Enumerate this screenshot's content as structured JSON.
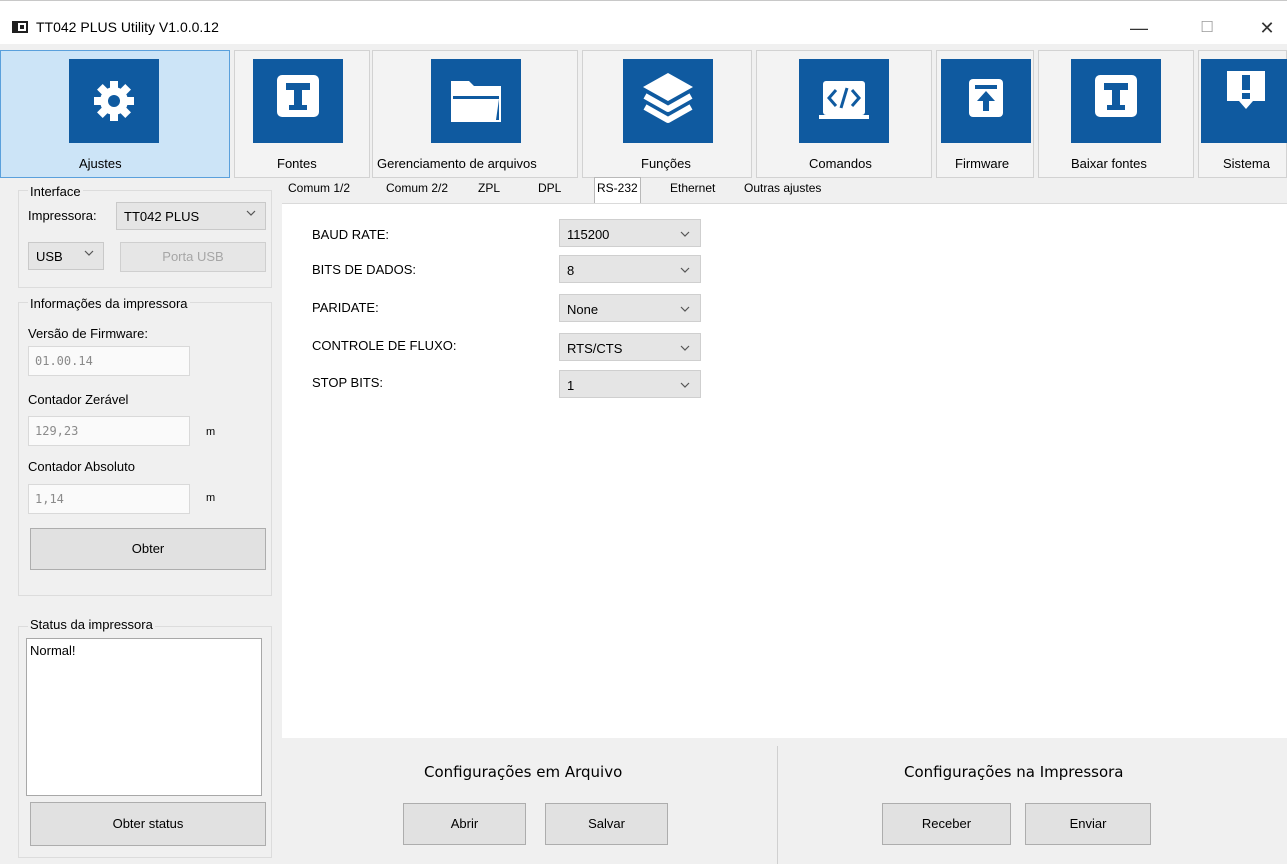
{
  "window": {
    "title": "TT042 PLUS Utility  V1.0.0.12",
    "controls": {
      "minimize": "—",
      "maximize": "☐",
      "close": "✕"
    }
  },
  "toolbar": {
    "items": [
      {
        "label": "Ajustes",
        "icon": "gear-icon",
        "active": true
      },
      {
        "label": "Fontes",
        "icon": "font-t-icon"
      },
      {
        "label": "Gerenciamento de arquivos",
        "icon": "folder-icon"
      },
      {
        "label": "Funções",
        "icon": "layers-icon"
      },
      {
        "label": "Comandos",
        "icon": "code-icon"
      },
      {
        "label": "Firmware",
        "icon": "upload-icon"
      },
      {
        "label": "Baixar fontes",
        "icon": "font-t-icon"
      },
      {
        "label": "Sistema",
        "icon": "alert-icon"
      }
    ]
  },
  "left": {
    "interface": {
      "title": "Interface",
      "printer_label": "Impressora:",
      "printer_value": "TT042 PLUS",
      "port_value": "USB",
      "port_button": "Porta USB"
    },
    "info": {
      "title": "Informações da impressora",
      "firmware_label": "Versão de Firmware:",
      "firmware_value": "01.00.14",
      "reset_counter_label": "Contador Zerável",
      "reset_counter_value": "129,23",
      "reset_counter_unit": "m",
      "abs_counter_label": "Contador Absoluto",
      "abs_counter_value": "1,14",
      "abs_counter_unit": "m",
      "get_button": "Obter"
    },
    "status": {
      "title": "Status da impressora",
      "text": "Normal!",
      "button": "Obter status"
    }
  },
  "tabs": {
    "items": [
      "Comum 1/2",
      "Comum 2/2",
      "ZPL",
      "DPL",
      "RS-232",
      "Ethernet",
      "Outras ajustes"
    ],
    "selected": "RS-232"
  },
  "rs232": {
    "rows": [
      {
        "label": "BAUD RATE:",
        "value": "115200"
      },
      {
        "label": "BITS DE DADOS:",
        "value": "8"
      },
      {
        "label": "PARIDATE:",
        "value": "None"
      },
      {
        "label": "CONTROLE DE FLUXO:",
        "value": "RTS/CTS"
      },
      {
        "label": "STOP BITS:",
        "value": "1"
      }
    ]
  },
  "file_config": {
    "title": "Configurações em Arquivo",
    "open": "Abrir",
    "save": "Salvar"
  },
  "printer_config": {
    "title": "Configurações na Impressora",
    "receive": "Receber",
    "send": "Enviar"
  }
}
